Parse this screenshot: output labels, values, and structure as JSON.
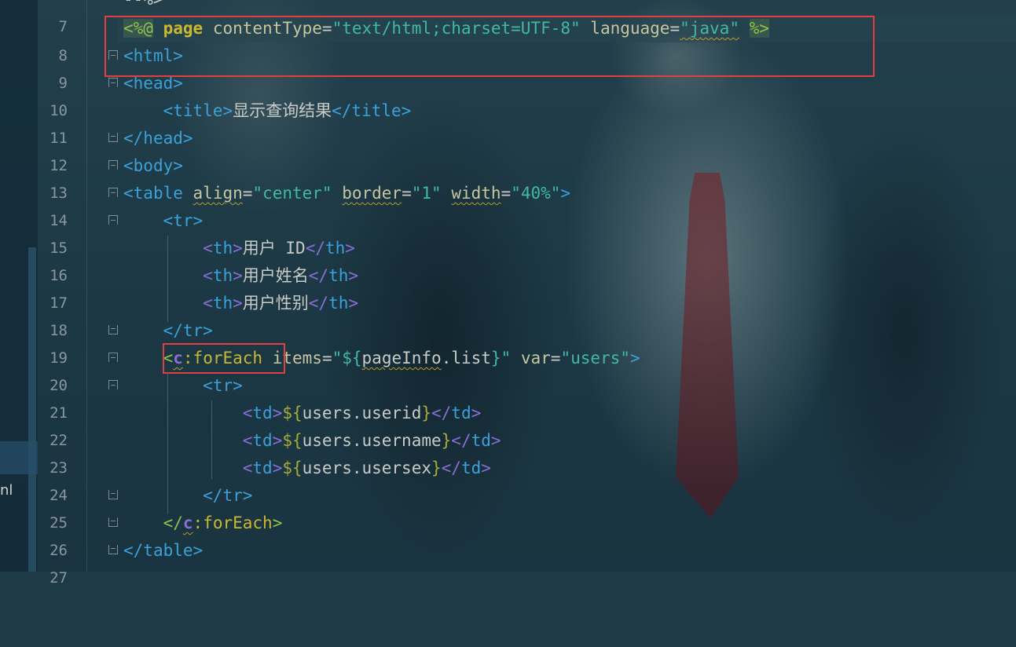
{
  "editor": {
    "partial_top": "--%>",
    "sidebar_partial_label": "nl",
    "lines": [
      {
        "num": "7"
      },
      {
        "num": "8",
        "t": [
          "<%@",
          " ",
          "page",
          " ",
          "contentType",
          "=",
          "\"text/html;charset=UTF-8\"",
          " ",
          "language",
          "=",
          "\"java\"",
          " ",
          "%>"
        ]
      },
      {
        "num": "9",
        "t": [
          "<",
          "html",
          ">"
        ]
      },
      {
        "num": "10",
        "t": [
          "<",
          "head",
          ">"
        ]
      },
      {
        "num": "11",
        "t": [
          "<",
          "title",
          ">",
          "显示查询结果",
          "</",
          "title",
          ">"
        ]
      },
      {
        "num": "12",
        "t": [
          "</",
          "head",
          ">"
        ]
      },
      {
        "num": "13",
        "t": [
          "<",
          "body",
          ">"
        ]
      },
      {
        "num": "14",
        "t": [
          "<",
          "table",
          " ",
          "align",
          "=",
          "\"center\"",
          " ",
          "border",
          "=",
          "\"1\"",
          " ",
          "width",
          "=",
          "\"40%\"",
          ">"
        ]
      },
      {
        "num": "15",
        "t": [
          "<",
          "tr",
          ">"
        ]
      },
      {
        "num": "16",
        "t": [
          "<",
          "th",
          ">",
          "用户 ID",
          "</",
          "th",
          ">"
        ]
      },
      {
        "num": "17",
        "t": [
          "<",
          "th",
          ">",
          "用户姓名",
          "</",
          "th",
          ">"
        ]
      },
      {
        "num": "18",
        "t": [
          "<",
          "th",
          ">",
          "用户性别",
          "</",
          "th",
          ">"
        ]
      },
      {
        "num": "19",
        "t": [
          "</",
          "tr",
          ">"
        ]
      },
      {
        "num": "20",
        "t": [
          "<",
          "c",
          ":",
          "forEach",
          " ",
          "items",
          "=",
          "\"${",
          "pageInfo",
          ".list",
          "}\"",
          " ",
          "var",
          "=",
          "\"users\"",
          ">"
        ]
      },
      {
        "num": "21",
        "t": [
          "<",
          "tr",
          ">"
        ]
      },
      {
        "num": "22",
        "t": [
          "<",
          "td",
          ">",
          "${",
          "users.userid",
          "}",
          "</",
          "td",
          ">"
        ]
      },
      {
        "num": "23",
        "t": [
          "<",
          "td",
          ">",
          "${",
          "users.username",
          "}",
          "</",
          "td",
          ">"
        ]
      },
      {
        "num": "24",
        "t": [
          "<",
          "td",
          ">",
          "${",
          "users.usersex",
          "}",
          "</",
          "td",
          ">"
        ]
      },
      {
        "num": "25",
        "t": [
          "</",
          "tr",
          ">"
        ]
      },
      {
        "num": "26",
        "t": [
          "</",
          "c",
          ":",
          "forEach",
          ">"
        ]
      },
      {
        "num": "27",
        "t": [
          "</",
          "table",
          ">"
        ]
      }
    ]
  }
}
